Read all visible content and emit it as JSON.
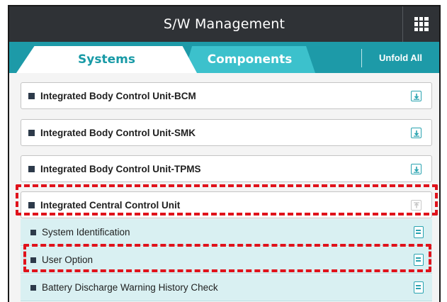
{
  "header": {
    "title": "S/W Management",
    "menu_icon": "grid-icon"
  },
  "tabs": [
    {
      "label": "Systems",
      "active": true
    },
    {
      "label": "Components",
      "active": false
    }
  ],
  "unfold_all_label": "Unfold All",
  "systems": [
    {
      "label": "Integrated Body Control Unit-BCM",
      "icon": "download-icon"
    },
    {
      "label": "Integrated Body Control Unit-SMK",
      "icon": "download-icon"
    },
    {
      "label": "Integrated Body Control Unit-TPMS",
      "icon": "download-icon"
    },
    {
      "label": "Integrated Central Control Unit",
      "icon": "upload-icon-disabled",
      "expanded": true
    }
  ],
  "sub_items": [
    {
      "label": "System Identification",
      "icon": "document-icon"
    },
    {
      "label": "User Option",
      "icon": "document-icon",
      "highlighted": true
    },
    {
      "label": "Battery Discharge Warning History Check",
      "icon": "document-icon"
    }
  ],
  "colors": {
    "titlebar": "#2f3236",
    "tabbar": "#1d9aa8",
    "active_tab_text": "#189aa6",
    "inactive_tab": "#3cc1cc",
    "subitem_bg": "#d9f0f2",
    "highlight": "#e0121b"
  }
}
